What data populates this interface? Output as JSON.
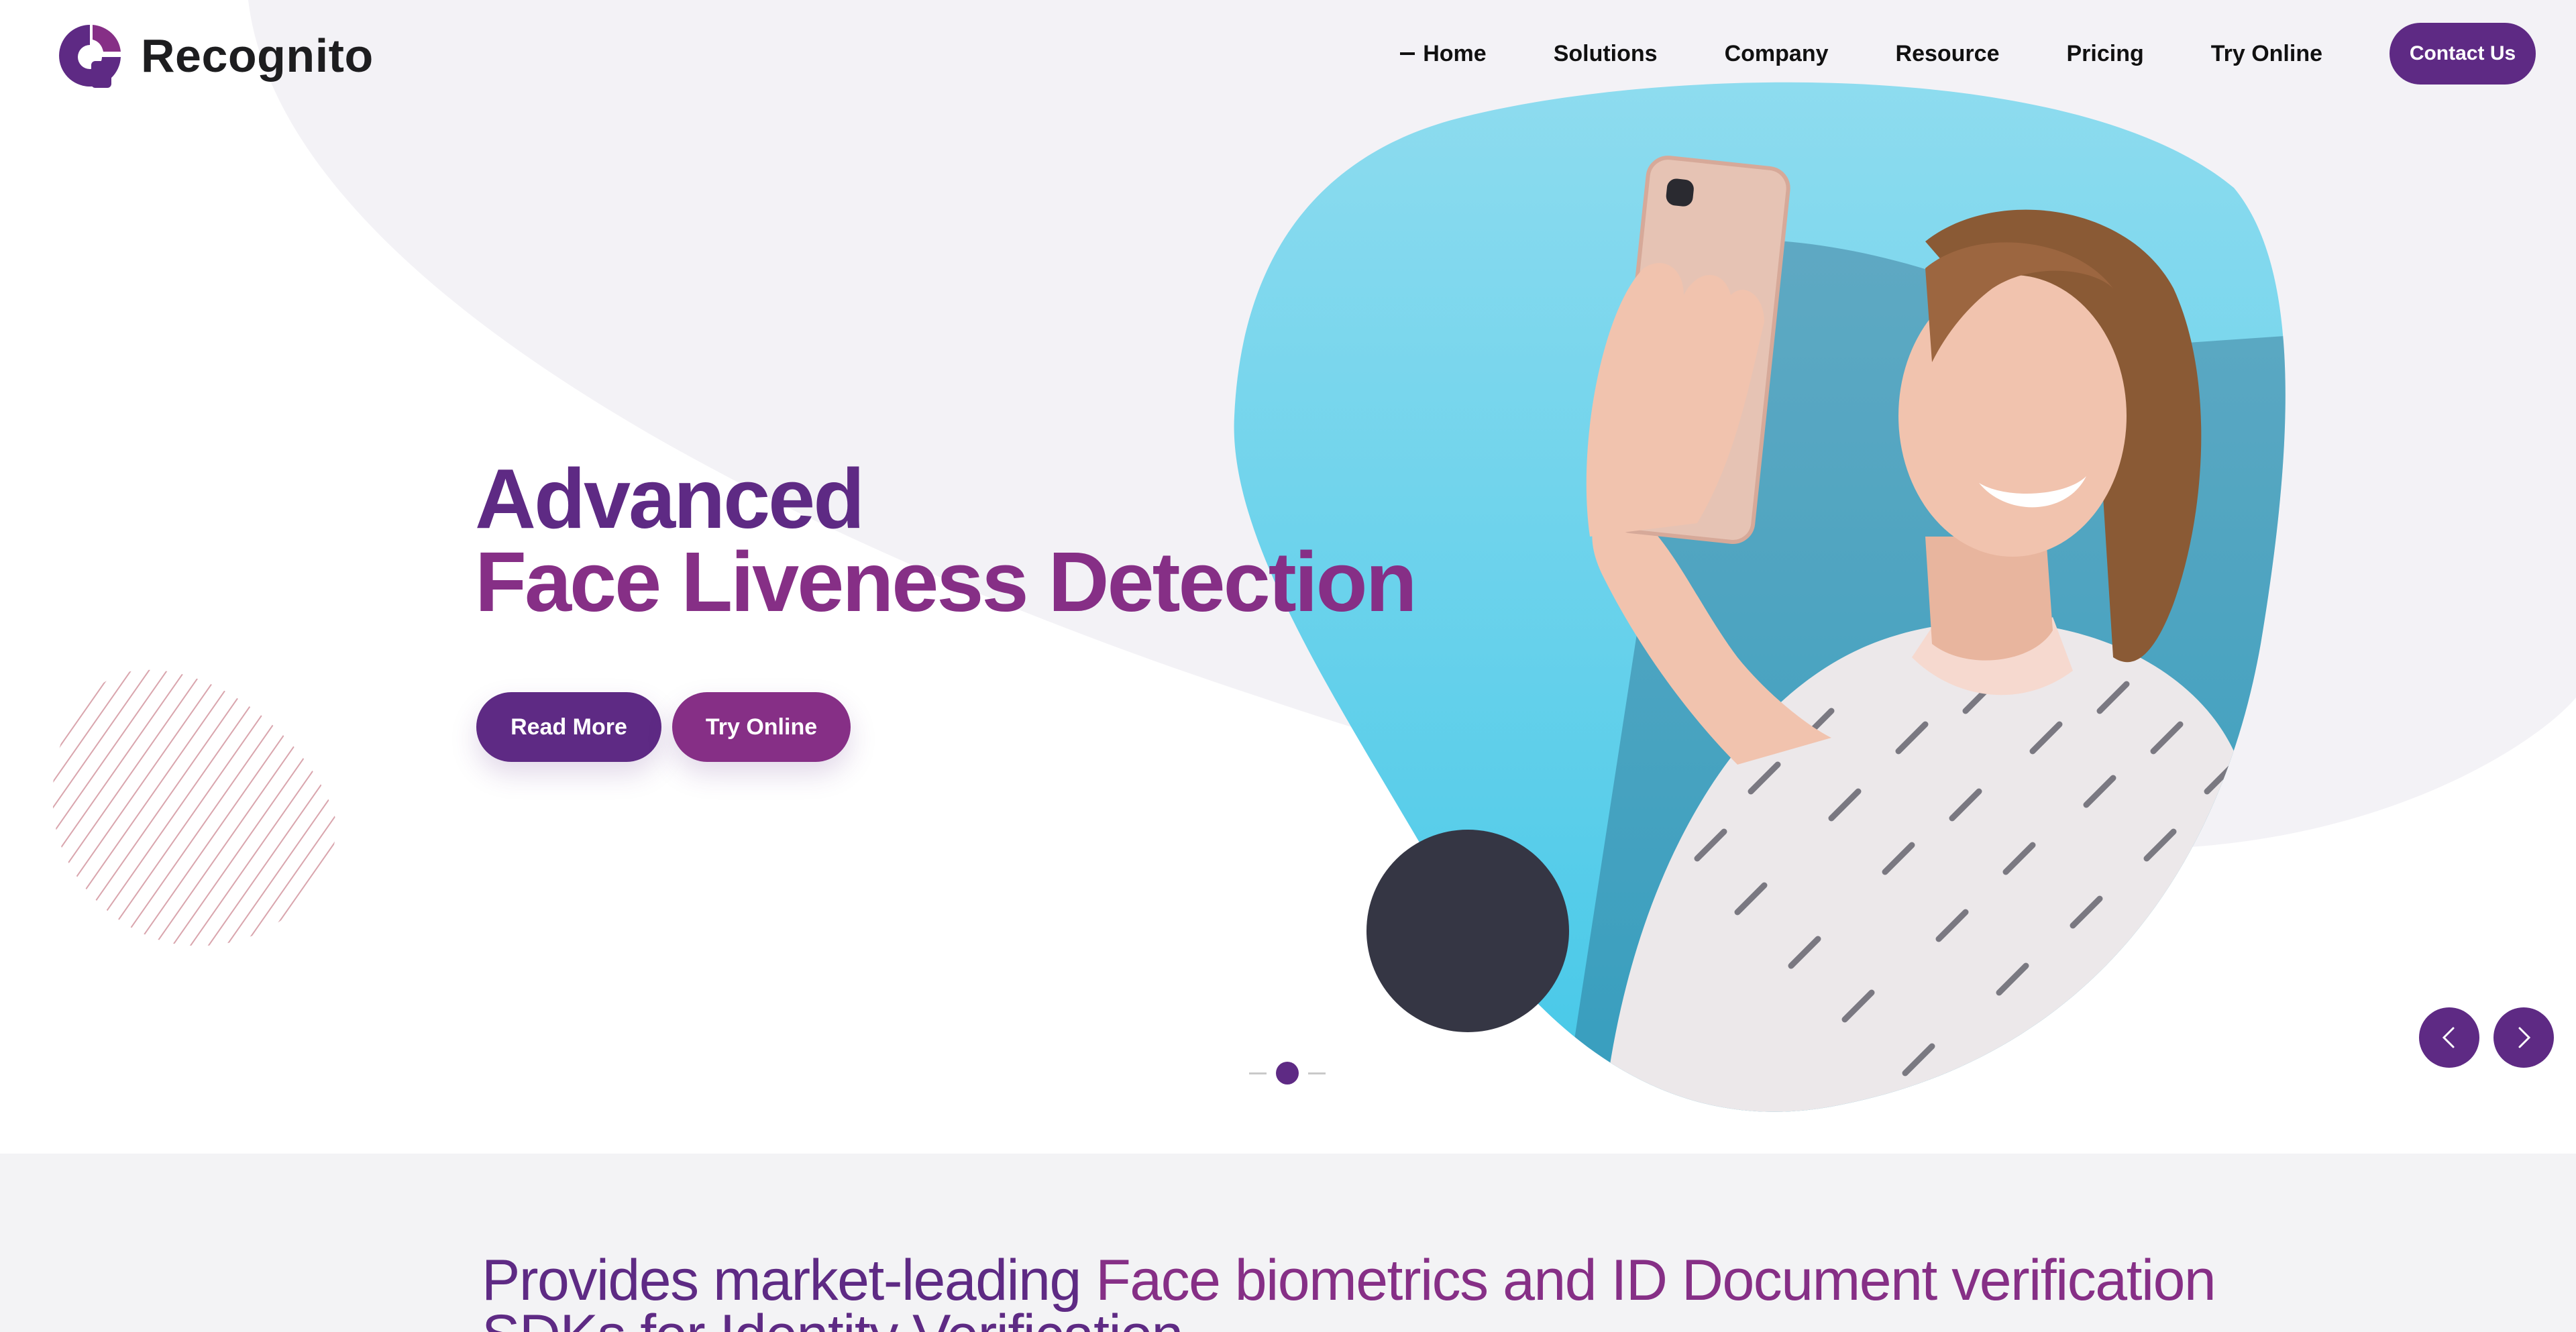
{
  "brand": {
    "name": "Recognito",
    "primary_color": "#5e2a84",
    "accent_color": "#862f86",
    "dark_color": "#353644"
  },
  "nav": {
    "items": [
      {
        "label": "Home",
        "active": true
      },
      {
        "label": "Solutions"
      },
      {
        "label": "Company"
      },
      {
        "label": "Resource"
      },
      {
        "label": "Pricing"
      },
      {
        "label": "Try Online"
      }
    ],
    "contact_label": "Contact Us"
  },
  "hero": {
    "title_line1": "Advanced",
    "title_line2": "Face Liveness Detection",
    "read_more_label": "Read More",
    "try_online_label": "Try Online",
    "slide_count": 1,
    "active_slide": 1,
    "prev_icon": "chevron-left-icon",
    "next_icon": "chevron-right-icon",
    "image": "woman-taking-selfie-photo"
  },
  "intro": {
    "text_plain_1": "Provides market-leading ",
    "text_accent_1": "Face biometrics and ID Document verification",
    "text_plain_2": " SDKs for Identity Verification"
  }
}
